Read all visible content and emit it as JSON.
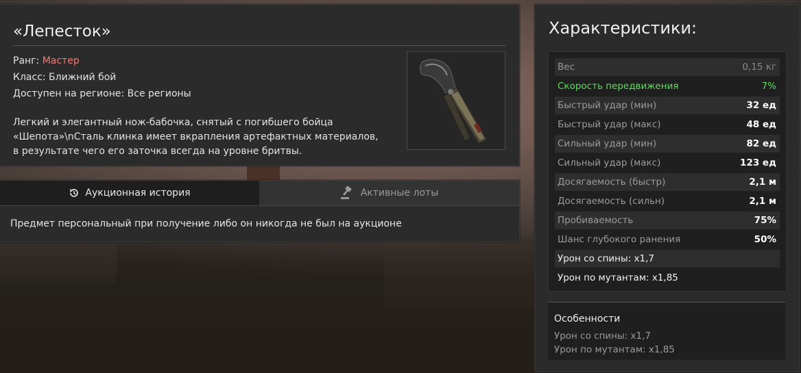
{
  "item": {
    "title": "«Лепесток»",
    "rank_label": "Ранг:",
    "rank_value": "Мастер",
    "class_line": "Класс: Ближний бой",
    "region_line": "Доступен на регионе: Все регионы",
    "description": "Легкий и элегантный нож-бабочка, снятый с погибшего бойца «Шепота»\\nСталь клинка имеет вкрапления артефактных материалов, в результате чего его заточка всегда на уровне бритвы.",
    "image_icon": "butterfly-knife-icon"
  },
  "auction": {
    "tabs": [
      {
        "label": "Аукционная история",
        "icon": "history-icon"
      },
      {
        "label": "Активные лоты",
        "icon": "gavel-icon"
      }
    ],
    "note": "Предмет персональный при получение либо он никогда не был на аукционе"
  },
  "stats": {
    "title": "Характеристики:",
    "rows": [
      {
        "key": "Вес",
        "value": "0,15 кг"
      },
      {
        "key": "Скорость передвижения",
        "value": "7%"
      },
      {
        "key": "Быстрый удар (мин)",
        "value": "32 ед"
      },
      {
        "key": "Быстрый удар (макс)",
        "value": "48 ед"
      },
      {
        "key": "Сильный удар (мин)",
        "value": "82 ед"
      },
      {
        "key": "Сильный удар (макс)",
        "value": "123 ед"
      },
      {
        "key": "Досягаемость (быстр)",
        "value": "2,1 м"
      },
      {
        "key": "Досягаемость (сильн)",
        "value": "2,1 м"
      },
      {
        "key": "Пробиваемость",
        "value": "75%"
      },
      {
        "key": "Шанс глубокого ранения",
        "value": "50%"
      },
      {
        "key": "Урон со спины: x1,7"
      },
      {
        "key": "Урон по мутантам: x1,85"
      }
    ],
    "colors": {
      "positive": "#5fdc5f",
      "rank": "#f07a72"
    }
  },
  "features": {
    "title": "Особенности",
    "lines": [
      "Урон со спины: x1,7",
      "Урон по мутантам: x1,85"
    ]
  }
}
